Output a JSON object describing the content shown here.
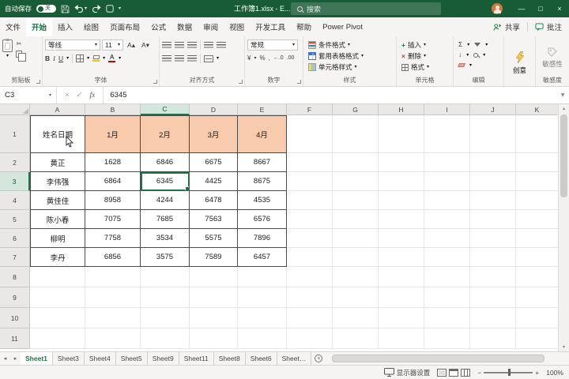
{
  "title_bar": {
    "autosave_label": "自动保存",
    "autosave_state": "关",
    "workbook_title": "工作簿1.xlsx - E...",
    "search_placeholder": "搜索"
  },
  "tabs": {
    "items": [
      "文件",
      "开始",
      "插入",
      "绘图",
      "页面布局",
      "公式",
      "数据",
      "审阅",
      "视图",
      "开发工具",
      "帮助",
      "Power Pivot"
    ],
    "active": "开始",
    "share": "共享",
    "comments": "批注"
  },
  "ribbon": {
    "clipboard": {
      "label": "剪贴板"
    },
    "font": {
      "label": "字体",
      "name": "等线",
      "size": "11"
    },
    "alignment": {
      "label": "对齐方式"
    },
    "number": {
      "label": "数字",
      "format": "常规"
    },
    "styles": {
      "label": "样式",
      "items": [
        "条件格式",
        "套用表格格式",
        "单元格样式"
      ]
    },
    "cells": {
      "label": "单元格",
      "items": [
        "插入",
        "删除",
        "格式"
      ]
    },
    "editing": {
      "label": "编辑"
    },
    "ideas": {
      "label": "创意"
    },
    "sensitivity": {
      "label": "敏感性",
      "group_label": "敏感度"
    }
  },
  "formula_bar": {
    "name_box": "C3",
    "value": "6345"
  },
  "sheet": {
    "columns": [
      "A",
      "B",
      "C",
      "D",
      "E",
      "F",
      "G",
      "H",
      "I",
      "J",
      "K"
    ],
    "rows": [
      "1",
      "2",
      "3",
      "4",
      "5",
      "6",
      "7",
      "8",
      "9",
      "10",
      "11"
    ],
    "selected_cell": "C3",
    "table": {
      "header": [
        "姓名日期",
        "1月",
        "2月",
        "3月",
        "4月"
      ],
      "data": [
        [
          "黄正",
          "1628",
          "6846",
          "6675",
          "8667"
        ],
        [
          "李伟强",
          "6864",
          "6345",
          "4425",
          "8675"
        ],
        [
          "黄佳佳",
          "8958",
          "4244",
          "6478",
          "4535"
        ],
        [
          "陈小春",
          "7075",
          "7685",
          "7563",
          "6576"
        ],
        [
          "柳明",
          "7758",
          "3534",
          "5575",
          "7896"
        ],
        [
          "李丹",
          "6856",
          "3575",
          "7589",
          "6457"
        ]
      ]
    }
  },
  "sheet_tabs": {
    "items": [
      "Sheet1",
      "Sheet3",
      "Sheet4",
      "Sheet5",
      "Sheet9",
      "Sheet11",
      "Sheet8",
      "Sheet6",
      "Sheet…"
    ],
    "active": "Sheet1"
  },
  "status_bar": {
    "display_settings": "显示器设置",
    "zoom": "100%"
  },
  "icons": {
    "caret_down": "▾",
    "caret_up": "▴",
    "caret_left": "◂",
    "caret_right": "▸",
    "minimize": "—",
    "maximize": "□",
    "close": "×",
    "check": "✓",
    "fx": "fx",
    "autosum": "Σ",
    "bold": "B",
    "italic": "I",
    "underline": "U",
    "letter_a": "A",
    "increase_font": "A▴",
    "decrease_font": "A▾",
    "currency": "¥",
    "percent": "%",
    "comma": ",",
    "increase_decimal": "←.0",
    "decrease_decimal": ".00",
    "cut": "✂",
    "plus": "+",
    "fill_down": "↓",
    "add": "+",
    "minus": "−"
  },
  "colors": {
    "titlebar": "#185C37",
    "accent": "#217346",
    "table_header_fill": "#F8CBAD"
  }
}
